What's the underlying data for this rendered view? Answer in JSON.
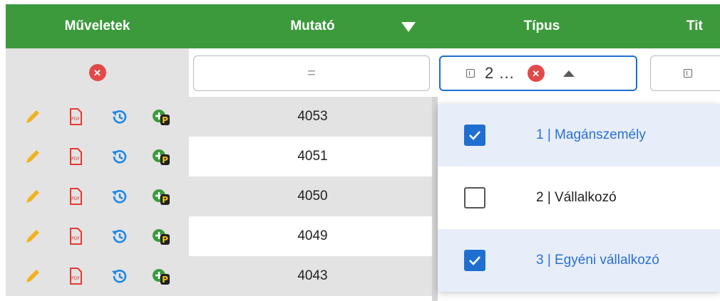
{
  "header": {
    "col_actions": "Műveletek",
    "col_mutato": "Mutató",
    "col_tipus": "Típus",
    "col_titulus": "Tit"
  },
  "filters": {
    "mutato_value": "=",
    "tipus_value": "2 ..."
  },
  "rows": [
    {
      "mutato": "4053"
    },
    {
      "mutato": "4051"
    },
    {
      "mutato": "4050"
    },
    {
      "mutato": "4049"
    },
    {
      "mutato": "4043"
    }
  ],
  "dropdown": {
    "options": [
      {
        "label": "1 | Magánszemély",
        "checked": true
      },
      {
        "label": "2 | Vállalkozó",
        "checked": false
      },
      {
        "label": "3 | Egyéni vállalkozó",
        "checked": true
      }
    ]
  },
  "colors": {
    "header_bg": "#3c9a3c",
    "accent_blue": "#1f6fd0",
    "clear_red": "#e24a4a",
    "pencil": "#f2b21c",
    "pdf": "#e53935",
    "history": "#1e88e5"
  }
}
